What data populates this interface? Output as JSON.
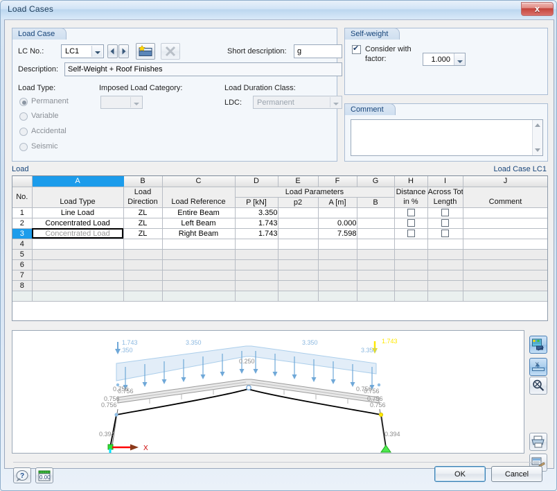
{
  "window": {
    "title": "Load Cases",
    "close_label": "x"
  },
  "load_case": {
    "group_title": "Load Case",
    "lc_no_label": "LC No.:",
    "lc_no_value": "LC1",
    "prev_icon": "previous-arrow-icon",
    "next_icon": "next-arrow-icon",
    "new_icon": "new-load-case-icon",
    "delete_icon": "delete-x-icon",
    "short_description_label": "Short description:",
    "short_description_value": "g",
    "description_label": "Description:",
    "description_value": "Self-Weight + Roof Finishes",
    "load_type_label": "Load Type:",
    "load_types": [
      {
        "label": "Permanent",
        "selected": true
      },
      {
        "label": "Variable",
        "selected": false
      },
      {
        "label": "Accidental",
        "selected": false
      },
      {
        "label": "Seismic",
        "selected": false
      }
    ],
    "imposed_label": "Imposed Load Category:",
    "imposed_value": "",
    "ldc_group_label": "Load Duration Class:",
    "ldc_label": "LDC:",
    "ldc_value": "Permanent"
  },
  "self_weight": {
    "group_title": "Self-weight",
    "consider_label_line1": "Consider with",
    "consider_label_line2": "factor:",
    "checked": true,
    "factor_value": "1.000"
  },
  "comment_panel": {
    "group_title": "Comment",
    "value": ""
  },
  "load": {
    "caption": "Load",
    "caption_right": "Load Case LC1",
    "column_letters": [
      "A",
      "B",
      "C",
      "D",
      "E",
      "F",
      "G",
      "H",
      "I",
      "J"
    ],
    "selected_column": "A",
    "no_label": "No.",
    "group_header": "Load Parameters",
    "headers": [
      {
        "line1": "",
        "line2": "Load Type"
      },
      {
        "line1": "Load",
        "line2": "Direction"
      },
      {
        "line1": "",
        "line2": "Load Reference"
      },
      {
        "line1": "",
        "line2": "P [kN]"
      },
      {
        "line1": "",
        "line2": "p2"
      },
      {
        "line1": "",
        "line2": "A [m]"
      },
      {
        "line1": "",
        "line2": "B"
      },
      {
        "line1": "Distance",
        "line2": "in %"
      },
      {
        "line1": "Across Tot",
        "line2": "Length"
      },
      {
        "line1": "",
        "line2": "Comment"
      }
    ],
    "rows": [
      {
        "no": "1",
        "load_type": "Line Load",
        "direction": "ZL",
        "reference": "Entire Beam",
        "p": "3.350",
        "p2": "",
        "a": "",
        "b": "",
        "distance_pct": false,
        "across_total": false,
        "comment": "",
        "selected": false
      },
      {
        "no": "2",
        "load_type": "Concentrated Load",
        "direction": "ZL",
        "reference": "Left Beam",
        "p": "1.743",
        "p2": "",
        "a": "0.000",
        "b": "",
        "distance_pct": false,
        "across_total": false,
        "comment": "",
        "selected": false
      },
      {
        "no": "3",
        "load_type": "Concentrated Load",
        "direction": "ZL",
        "reference": "Right Beam",
        "p": "1.743",
        "p2": "",
        "a": "7.598",
        "b": "",
        "distance_pct": false,
        "across_total": false,
        "comment": "",
        "selected": true
      }
    ],
    "empty_row_numbers": [
      "4",
      "5",
      "6",
      "7",
      "8"
    ]
  },
  "graphic": {
    "toolbar": [
      {
        "name": "render-view-button",
        "icon": "render-view-icon",
        "active": true
      },
      {
        "name": "dimension-button",
        "icon": "dimension-x-icon",
        "active": true
      },
      {
        "name": "zoom-reset-button",
        "icon": "magnifier-icon",
        "active": false
      },
      {
        "name": "print-button",
        "icon": "printer-icon",
        "active": false
      },
      {
        "name": "print-preview-button",
        "icon": "print-to-report-icon",
        "active": false
      }
    ],
    "labels": {
      "line_load_left": "3.350",
      "line_load_right": "3.350",
      "conc_load_left": "1.743",
      "conc_load_right": "1.743",
      "ridge": "0.250",
      "beam_left_a": "0.756",
      "beam_left_b": "0.756",
      "beam_left_c": "0.756",
      "beam_right_a": "0.756",
      "beam_right_b": "0.756",
      "beam_right_c": "0.756",
      "column_left": "0.394",
      "column_right": "0.394",
      "axis_x": "X"
    },
    "colors": {
      "load_blue": "#9dc6e8",
      "load_fill": "#ddeaf7",
      "highlight_yellow": "#ffe800",
      "support_green": "#33dd33",
      "axis_red": "#ff0000",
      "axis_cyan": "#00e5ff"
    }
  },
  "footer": {
    "help_icon": "help-question-icon",
    "units_icon": "units-settings-icon",
    "ok_label": "OK",
    "cancel_label": "Cancel"
  }
}
